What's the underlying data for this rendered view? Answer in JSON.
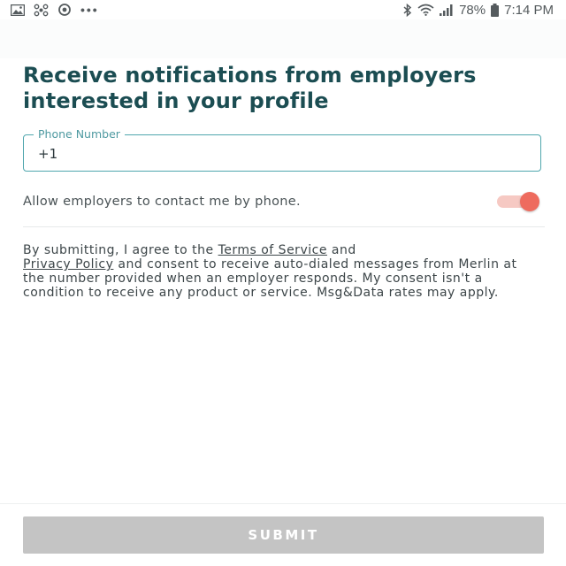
{
  "status_bar": {
    "left_icons": [
      "image-icon",
      "pinwheel-icon",
      "sync-icon"
    ],
    "overflow": "•••",
    "right_icons": [
      "bluetooth-icon",
      "wifi-icon",
      "signal-icon",
      "battery-icon"
    ],
    "battery": "78%",
    "time": "7:14 PM"
  },
  "heading": "Receive notifications from employers interested in your profile",
  "phone_field": {
    "label": "Phone Number",
    "value": "+1"
  },
  "allow_contact": {
    "label": "Allow employers to contact me by phone.",
    "enabled": true,
    "accent_color": "#ee6b5e"
  },
  "consent": {
    "text_1": "By submitting, I agree to the ",
    "terms_link": "Terms of Service",
    "text_2": " and ",
    "privacy_link": "Privacy Policy",
    "text_3": " and consent to receive auto-dialed messages from Merlin at the number provided when an employer responds. My consent isn't a condition to receive any product or service. Msg&Data rates may apply."
  },
  "submit_label": "SUBMIT",
  "colors": {
    "heading": "#1b4d52",
    "field_border": "#4fa6ad",
    "submit_disabled": "#c4c4c4"
  }
}
